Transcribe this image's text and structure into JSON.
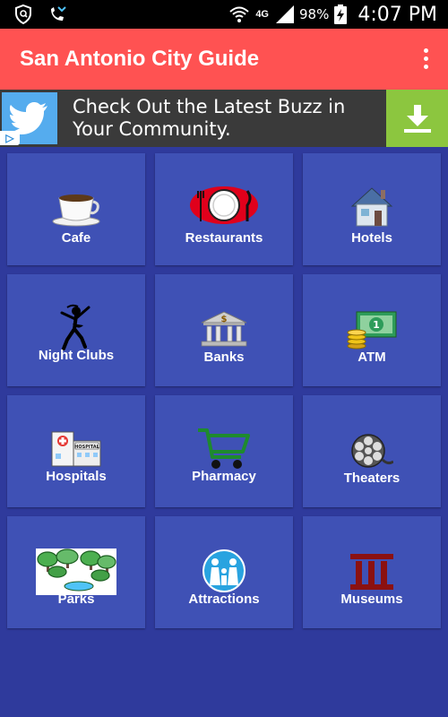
{
  "status_bar": {
    "battery": "98%",
    "time": "4:07 PM",
    "network": "4G"
  },
  "app_bar": {
    "title": "San Antonio City Guide",
    "menu_icon": "overflow-menu-icon"
  },
  "ad": {
    "icon": "twitter-bird-icon",
    "text": "Check Out the Latest Buzz in Your Community.",
    "download_icon": "download-icon",
    "choices_icon": "adchoices-icon"
  },
  "categories": [
    {
      "label": "Cafe",
      "icon": "coffee-cup-icon"
    },
    {
      "label": "Restaurants",
      "icon": "plate-cutlery-icon"
    },
    {
      "label": "Hotels",
      "icon": "house-icon"
    },
    {
      "label": "Night Clubs",
      "icon": "dancer-icon"
    },
    {
      "label": "Banks",
      "icon": "bank-icon"
    },
    {
      "label": "ATM",
      "icon": "cash-coins-icon"
    },
    {
      "label": "Hospitals",
      "icon": "hospital-icon"
    },
    {
      "label": "Pharmacy",
      "icon": "shopping-cart-icon"
    },
    {
      "label": "Theaters",
      "icon": "film-reel-icon"
    },
    {
      "label": "Parks",
      "icon": "park-trees-icon"
    },
    {
      "label": "Attractions",
      "icon": "family-icon"
    },
    {
      "label": "Museums",
      "icon": "museum-columns-icon"
    }
  ],
  "colors": {
    "background": "#2f3a9c",
    "tile": "#3f51b5",
    "app_bar": "#ff5252",
    "ad_bar": "#3a3a3a",
    "download": "#8cc63f"
  }
}
